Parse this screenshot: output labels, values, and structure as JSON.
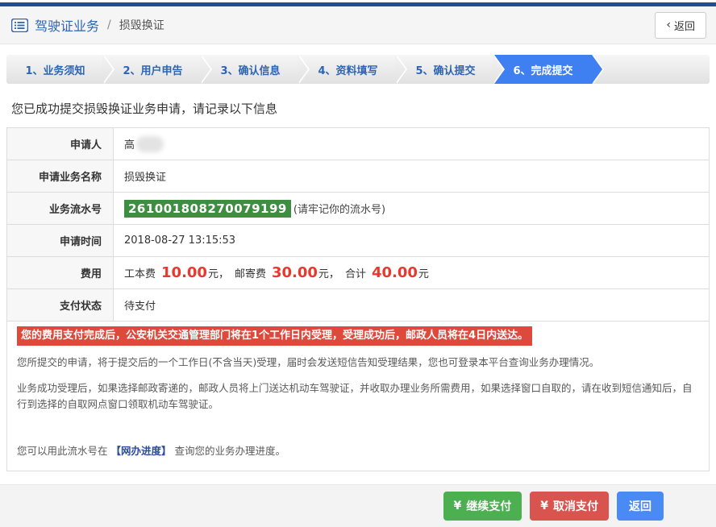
{
  "header": {
    "title": "驾驶证业务",
    "separator": "/",
    "subtitle": "损毁换证",
    "back": {
      "icon": "‹",
      "label": "返回"
    }
  },
  "steps": [
    {
      "label": "1、业务须知",
      "active": false
    },
    {
      "label": "2、用户申告",
      "active": false
    },
    {
      "label": "3、确认信息",
      "active": false
    },
    {
      "label": "4、资料填写",
      "active": false
    },
    {
      "label": "5、确认提交",
      "active": false
    },
    {
      "label": "6、完成提交",
      "active": true
    }
  ],
  "success_message": "您已成功提交损毁换证业务申请，请记录以下信息",
  "table": {
    "rows": [
      {
        "label": "申请人",
        "value": "高"
      },
      {
        "label": "申请业务名称",
        "value": "损毁换证"
      },
      {
        "label": "业务流水号",
        "badge": "261001808270079199",
        "note": "(请牢记你的流水号)"
      },
      {
        "label": "申请时间",
        "value": "2018-08-27 13:15:53"
      },
      {
        "label": "费用",
        "segments": [
          {
            "label": "工本费",
            "amount": "10.00",
            "suffix": "元，"
          },
          {
            "label": "邮寄费",
            "amount": "30.00",
            "suffix": "元，"
          },
          {
            "label": "合计",
            "amount": "40.00",
            "suffix": "元"
          }
        ]
      },
      {
        "label": "支付状态",
        "value": "待支付"
      }
    ]
  },
  "notes": {
    "warning": "您的费用支付完成后，公安机关交通管理部门将在1个工作日内受理，受理成功后，邮政人员将在4日内送达。",
    "paragraph1": "您所提交的申请，将于提交后的一个工作日(不含当天)受理，届时会发送短信告知受理结果，您也可登录本平台查询业务办理情况。",
    "paragraph2": "业务成功受理后，如果选择邮政寄递的，邮政人员将上门送达机动车驾驶证，并收取办理业务所需费用，如果选择窗口自取的，请在收到短信通知后，自行到选择的自取网点窗口领取机动车驾驶证。",
    "progress_prefix": "您可以用此流水号在",
    "progress_link": "【网办进度】",
    "progress_suffix": "查询您的业务办理进度。"
  },
  "footer": {
    "buttons": [
      {
        "icon": "¥",
        "label": "继续支付"
      },
      {
        "icon": "¥",
        "label": "取消支付"
      },
      {
        "label": "返回"
      }
    ]
  },
  "colors": {
    "top_bar_navy": "#1e4f91",
    "title_blue": "#2d64b3",
    "step_active_blue": "#3e7ff2",
    "badge_green": "#3e8e41",
    "amount_red": "#e8392f",
    "warning_red": "#dd4a3b",
    "button_green": "#4caf50",
    "button_red": "#d9534f",
    "button_blue": "#4a8af4"
  }
}
